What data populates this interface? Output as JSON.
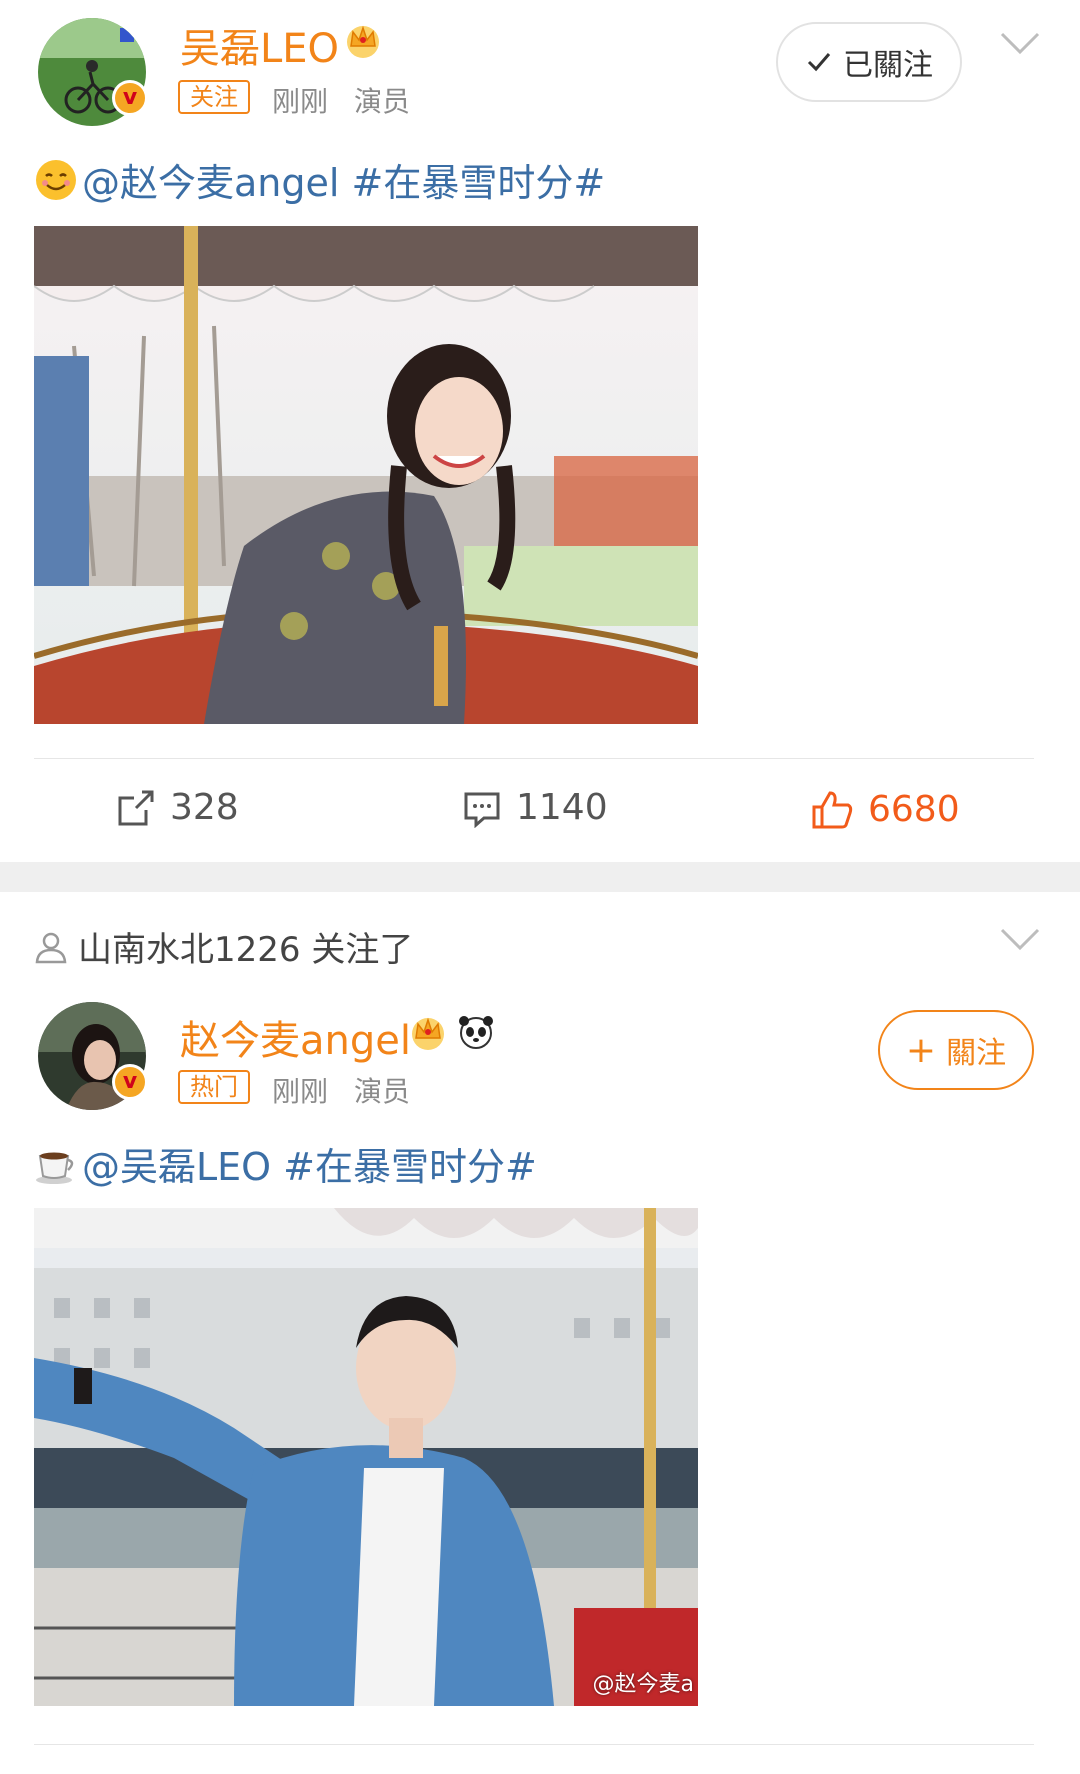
{
  "colors": {
    "brand_orange": "#f28419",
    "link_blue": "#3b6ea5",
    "like_red": "#f25b1a",
    "meta_gray": "#8a8a8a"
  },
  "post1": {
    "username": "吴磊LEO",
    "tag": "关注",
    "time": "刚刚",
    "role": "演员",
    "follow_button": "已關注",
    "text": "@赵今麦angel #在暴雪时分#",
    "emoji": "smiling-emoji",
    "actions": {
      "repost": "328",
      "comment": "1140",
      "like": "6680"
    }
  },
  "post2": {
    "notice": "山南水北1226 关注了",
    "username": "赵今麦angel",
    "tag": "热门",
    "time": "刚刚",
    "role": "演员",
    "follow_button": "關注",
    "follow_prefix": "+",
    "text": "@吴磊LEO #在暴雪时分#",
    "emoji": "coffee-cup-emoji",
    "watermark": "@赵今麦a"
  }
}
